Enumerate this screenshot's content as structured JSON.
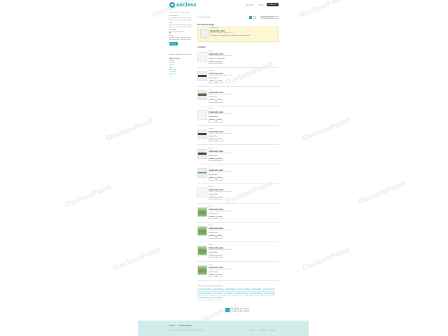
{
  "watermark_text": "OsclassPoint",
  "header": {
    "logo_text": "osclass",
    "links": [
      "Be seller",
      "Log in"
    ],
    "publish_label": "Publish ad"
  },
  "breadcrumb": "Osclass Demo › Search results",
  "sidebar": {
    "labels": [
      "Your search",
      "City",
      "Show only",
      "Price"
    ],
    "checkbox_label": "Listings with pictures",
    "apply_label": "Apply",
    "subscribe_label": "Receive notifications for this search",
    "categories_title": "Refine category",
    "categories": [
      "For sale",
      "Vehicles",
      "Services",
      "Jobs",
      "Real estate",
      "Community",
      "Personals",
      "Pets"
    ]
  },
  "main": {
    "results_text": "1 - 12 of 16 listings",
    "sort_label": "Sort by: Newest first",
    "premium_title": "Premium listings",
    "listings_title": "Listings"
  },
  "premium": {
    "category": "Computer parts",
    "title": "Check with seller",
    "meta": "Mumbai, IN - Maharashtra - September 3, 2020",
    "description": "Description of this example ad. Check item details and information in full."
  },
  "listings": [
    {
      "category": "Houses",
      "title": "Check with seller",
      "meta": "Mumbai, IN - Maharashtra - September 10, 2020",
      "description": "Nice house to rent downtown",
      "thumb": "light"
    },
    {
      "category": "Furniture",
      "title": "Check with seller",
      "meta": "Mumbai, IN - Maharashtra - September 10, 2020",
      "description": "MedallesStallhos",
      "thumb": "dark"
    },
    {
      "category": "Cars",
      "title": "Check with seller",
      "meta": "Mumbai, IN - Maharashtra - September 10, 2020",
      "description": "MedallesStallhos",
      "thumb": "brown"
    },
    {
      "category": "Electronics",
      "title": "Check with seller",
      "meta": "Mumbai, IN - Maharashtra - September 10, 2020",
      "description": "MedallesStallhos",
      "thumb": "light"
    },
    {
      "category": "Furniture",
      "title": "Check with seller",
      "meta": "Mumbai, IN - Maharashtra - September 10, 2020",
      "description": "MedallesStallhos",
      "thumb": "dark"
    },
    {
      "category": "Electronics",
      "title": "Check with seller",
      "meta": "Mumbai, IN - Maharashtra - September 10, 2020",
      "description": "MedallesStallhos",
      "thumb": "dark"
    },
    {
      "category": "Cars",
      "title": "Check with seller",
      "meta": "Mumbai, IN - Maharashtra - September 10, 2020",
      "description": "MedallesStallhos",
      "thumb": "blue"
    },
    {
      "category": "Services",
      "title": "Check with seller",
      "meta": "Mumbai, IN - Maharashtra - September 10, 2020",
      "description": "MedallesStallhos",
      "thumb": "light"
    },
    {
      "category": "Garden",
      "title": "Check with seller",
      "meta": "Mumbai, IN - Maharashtra - September 10, 2020",
      "description": "MedallesStallhos",
      "thumb": "green"
    },
    {
      "category": "Garden",
      "title": "Check with seller",
      "meta": "Mumbai, IN - Maharashtra - September 10, 2020",
      "description": "MedallesStallhos",
      "thumb": "green"
    },
    {
      "category": "Garden",
      "title": "Check with seller",
      "meta": "Mumbai, IN - Maharashtra - September 10, 2020",
      "description": "MedallesStallhos",
      "thumb": "green"
    },
    {
      "category": "Garden",
      "title": "Check with seller",
      "meta": "Mumbai, IN - Maharashtra - September 10, 2020",
      "description": "MedallesStallhos",
      "thumb": "green"
    }
  ],
  "listing_buttons": [
    "Add note",
    "Details"
  ],
  "related": {
    "title": "Other searches that may interest you",
    "tags": [
      "Cars for sale in Mumbai",
      "Furniture in Mumbai",
      "Houses in Mumbai",
      "Electronics in Mumbai",
      "Garden in Mumbai",
      "Services in Mumbai",
      "Computer parts in Mumbai",
      "Jobs in Mumbai",
      "Pets in Mumbai",
      "Community in Mumbai",
      "Real estate in Mumbai",
      "Personals in Mumbai",
      "Vehicles in Mumbai",
      "For sale in Mumbai"
    ]
  },
  "pager": [
    "1",
    "2",
    "3",
    "›",
    "»"
  ],
  "footer": {
    "links": [
      "Contact",
      "Osclass page title"
    ],
    "copyright": "This website is proudly using the classifieds scripts software Osclass",
    "bottom_links": [
      "Contact Us",
      "Osclass themes",
      "Developers"
    ]
  },
  "colors": {
    "accent": "#20a3b7",
    "premium_bg": "#fcf8d6",
    "footer_bg": "#d1ecea"
  }
}
